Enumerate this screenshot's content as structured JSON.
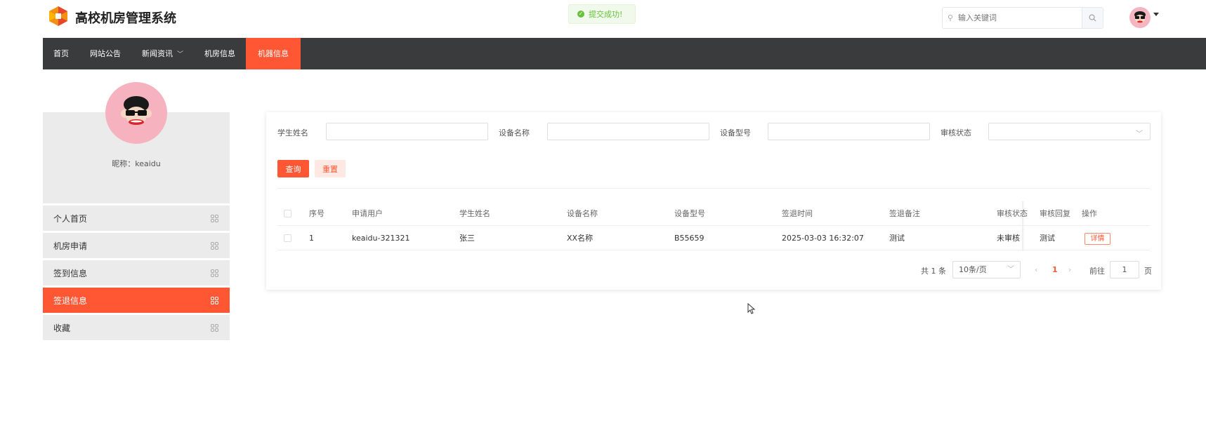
{
  "header": {
    "site_title": "高校机房管理系统",
    "toast_text": "提交成功!",
    "search_placeholder": "输入关键词",
    "brand_color": "#ff5733"
  },
  "nav": {
    "items": [
      {
        "label": "首页"
      },
      {
        "label": "网站公告"
      },
      {
        "label": "新闻资讯",
        "has_dropdown": true
      },
      {
        "label": "机房信息"
      },
      {
        "label": "机器信息",
        "active": true
      }
    ]
  },
  "sidebar": {
    "nickname": "昵称：keaidu",
    "items": [
      {
        "label": "个人首页"
      },
      {
        "label": "机房申请"
      },
      {
        "label": "签到信息"
      },
      {
        "label": "签退信息",
        "active": true
      },
      {
        "label": "收藏"
      }
    ]
  },
  "filters": {
    "student_name_label": "学生姓名",
    "student_name_value": "",
    "device_name_label": "设备名称",
    "device_name_value": "",
    "device_model_label": "设备型号",
    "device_model_value": "",
    "review_status_label": "审核状态",
    "review_status_value": "",
    "query_label": "查询",
    "reset_label": "重置"
  },
  "table": {
    "columns": [
      "序号",
      "申请用户",
      "学生姓名",
      "设备名称",
      "设备型号",
      "签退时间",
      "签退备注",
      "审核状态",
      "审核回复",
      "操作"
    ],
    "rows": [
      {
        "index": "1",
        "user": "keaidu-321321",
        "student": "张三",
        "device_name": "XX名称",
        "device_model": "B55659",
        "time": "2025-03-03 16:32:07",
        "remark": "测试",
        "status": "未审核",
        "reply": "测试",
        "action": "详情"
      }
    ]
  },
  "pagination": {
    "total": "共 1 条",
    "page_size": "10条/页",
    "current_page": "1",
    "goto_label": "前往",
    "goto_value": "1",
    "page_suffix": "页"
  }
}
